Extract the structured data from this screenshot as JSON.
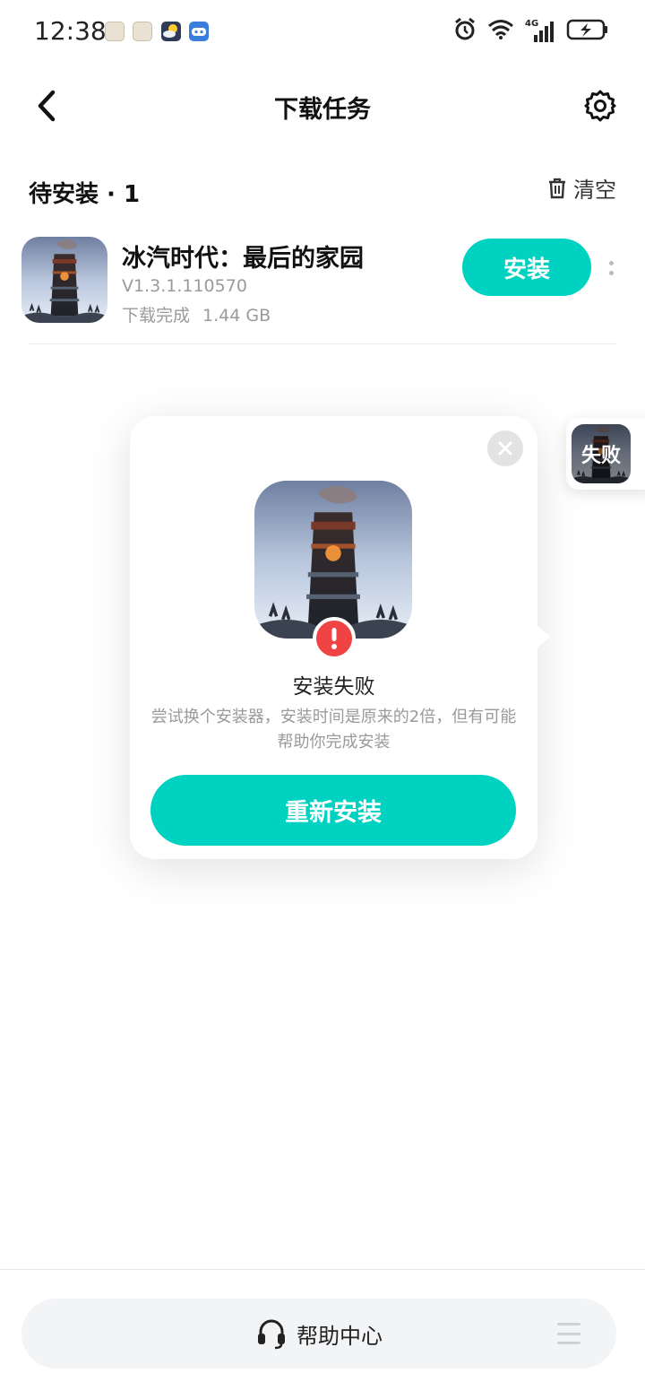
{
  "status_bar": {
    "time": "12:38",
    "notification_icons": [
      "huawei-app-icon",
      "huawei-app-icon",
      "weather-icon",
      "game-controller-icon"
    ],
    "right_icons": [
      "alarm-icon",
      "wifi-icon",
      "signal-4g-icon",
      "battery-charging-icon"
    ],
    "network_label": "4G"
  },
  "header": {
    "title": "下载任务",
    "back_icon": "chevron-left-icon",
    "settings_icon": "gear-icon"
  },
  "section": {
    "title": "待安装 · 1",
    "clear_label": "清空",
    "clear_icon": "trash-icon"
  },
  "tasks": [
    {
      "name": "冰汽时代：最后的家园",
      "version": "V1.3.1.110570",
      "status": "下载完成",
      "size": "1.44 GB",
      "action_label": "安装"
    }
  ],
  "dialog": {
    "title": "安装失败",
    "description": "尝试换个安装器，安装时间是原来的2倍，但有可能帮助你完成安装",
    "button_label": "重新安装",
    "error_icon": "exclamation-icon",
    "close_icon": "close-icon"
  },
  "floating_badge": {
    "label": "失败"
  },
  "bottom_bar": {
    "help_label": "帮助中心",
    "help_icon": "headset-icon",
    "menu_icon": "menu-icon"
  },
  "colors": {
    "accent": "#00d2c1",
    "error": "#f04343",
    "secondary_text": "#9a9a9a"
  }
}
